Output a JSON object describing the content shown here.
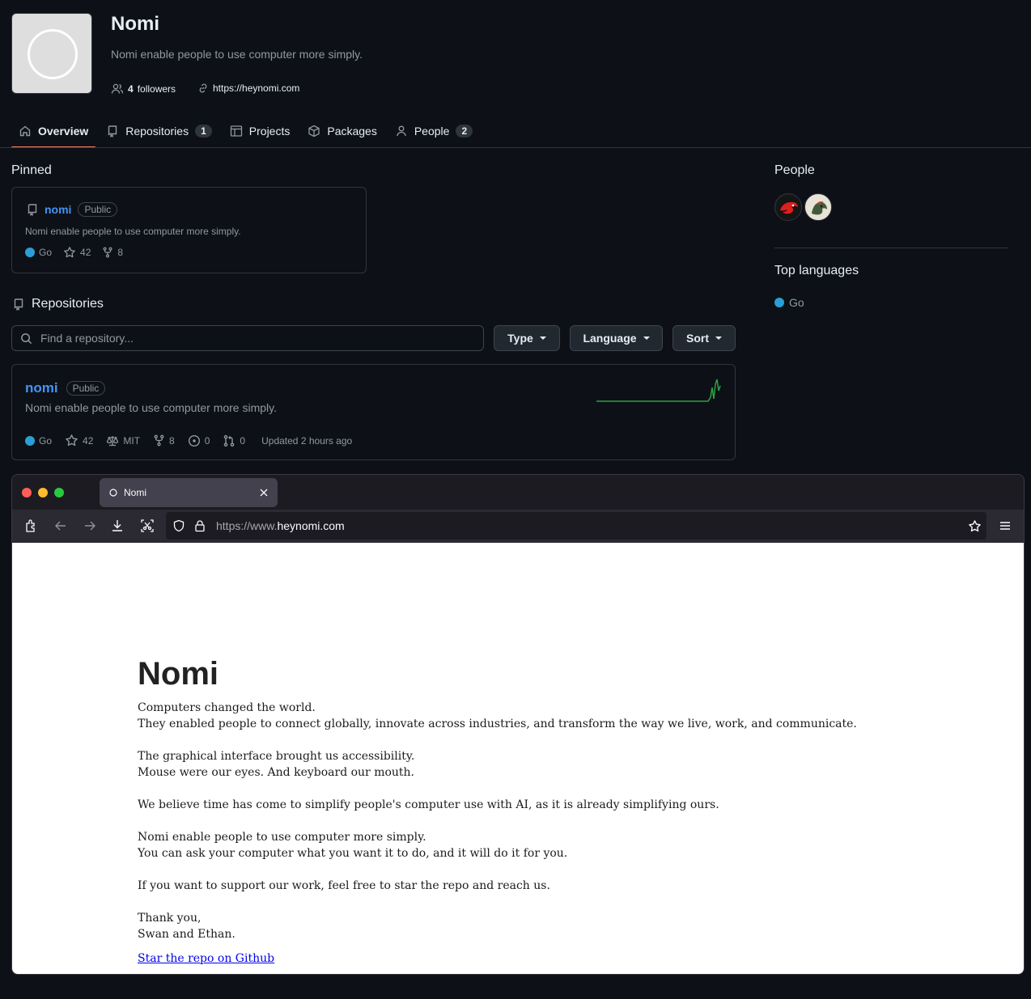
{
  "org": {
    "name": "Nomi",
    "description": "Nomi enable people to use computer more simply.",
    "followers_count": "4",
    "followers_label": "followers",
    "website": "https://heynomi.com"
  },
  "nav": {
    "tabs": [
      {
        "label": "Overview",
        "icon": "home-icon",
        "active": true
      },
      {
        "label": "Repositories",
        "icon": "repo-icon",
        "count": "1"
      },
      {
        "label": "Projects",
        "icon": "table-icon"
      },
      {
        "label": "Packages",
        "icon": "package-icon"
      },
      {
        "label": "People",
        "icon": "person-icon",
        "count": "2"
      }
    ]
  },
  "pinned": {
    "heading": "Pinned",
    "repo": {
      "name": "nomi",
      "visibility": "Public",
      "description": "Nomi enable people to use computer more simply.",
      "language": "Go",
      "stars": "42",
      "forks": "8"
    }
  },
  "repositories": {
    "heading": "Repositories",
    "search_placeholder": "Find a repository...",
    "filters": {
      "type": "Type",
      "language": "Language",
      "sort": "Sort"
    },
    "items": [
      {
        "name": "nomi",
        "visibility": "Public",
        "description": "Nomi enable people to use computer more simply.",
        "language": "Go",
        "stars": "42",
        "license": "MIT",
        "forks": "8",
        "issues": "0",
        "pull_requests": "0",
        "updated": "Updated 2 hours ago"
      }
    ]
  },
  "sidebar": {
    "people_heading": "People",
    "top_languages_heading": "Top languages",
    "languages": [
      {
        "name": "Go"
      }
    ]
  },
  "colors": {
    "accent_underline": "#f78166",
    "link": "#4493f8",
    "go_language": "#2a9fd6",
    "activity_graph": "#2ea043"
  },
  "browser": {
    "tab_title": "Nomi",
    "url_prefix": "https://www.",
    "url_domain": "heynomi.com",
    "page": {
      "title": "Nomi",
      "lines": [
        "Computers changed the world.",
        "They enabled people to connect globally, innovate across industries, and transform the way we live, work, and communicate.",
        "The graphical interface brought us accessibility.",
        "Mouse were our eyes. And keyboard our mouth.",
        "We believe time has come to simplify people's computer use with AI, as it is already simplifying ours.",
        "Nomi enable people to use computer more simply.",
        "You can ask your computer what you want it to do, and it will do it for you.",
        "If you want to support our work, feel free to star the repo and reach us.",
        "Thank you,",
        "Swan and Ethan."
      ],
      "link_text": "Star the repo on Github"
    }
  }
}
